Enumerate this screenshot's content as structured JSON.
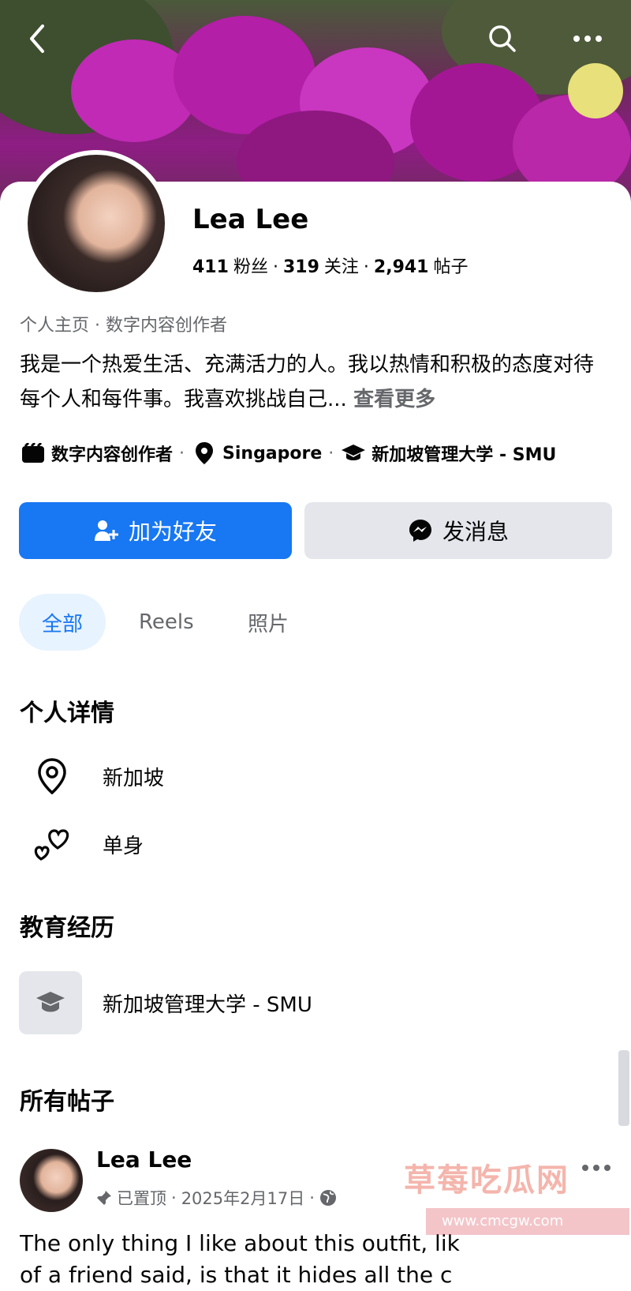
{
  "profile": {
    "name": "Lea Lee",
    "followers_count": "411",
    "followers_label": "粉丝",
    "following_count": "319",
    "following_label": "关注",
    "posts_count": "2,941",
    "posts_label": "帖子",
    "separator": "·",
    "category": "个人主页 · 数字内容创作者",
    "bio": "我是一个热爱生活、充满活力的人。我以热情和积极的态度对待每个人和每件事。我喜欢挑战自己...",
    "see_more": "查看更多",
    "meta": {
      "job": "数字内容创作者",
      "location": "Singapore",
      "school": "新加坡管理大学 - SMU"
    }
  },
  "actions": {
    "add_friend": "加为好友",
    "message": "发消息"
  },
  "tabs": [
    {
      "label": "全部",
      "active": true
    },
    {
      "label": "Reels",
      "active": false
    },
    {
      "label": "照片",
      "active": false
    }
  ],
  "details": {
    "title": "个人详情",
    "items": [
      {
        "icon": "location-pin-icon",
        "text": "新加坡"
      },
      {
        "icon": "hearts-icon",
        "text": "单身"
      }
    ]
  },
  "education": {
    "title": "教育经历",
    "school": "新加坡管理大学 - SMU"
  },
  "posts": {
    "title": "所有帖子",
    "author": "Lea Lee",
    "pinned_label": "已置顶",
    "date": "2025年2月17日",
    "text_line1": "The only thing I like about this outfit, lik",
    "text_line2": "of a friend said, is that it hides all the c"
  },
  "watermark": {
    "text": "草莓吃瓜网",
    "url": "www.cmcgw.com"
  },
  "colors": {
    "primary": "#1877f2",
    "secondary_bg": "#e4e6eb",
    "muted_text": "#65676b",
    "active_tab_bg": "#e7f3ff"
  }
}
